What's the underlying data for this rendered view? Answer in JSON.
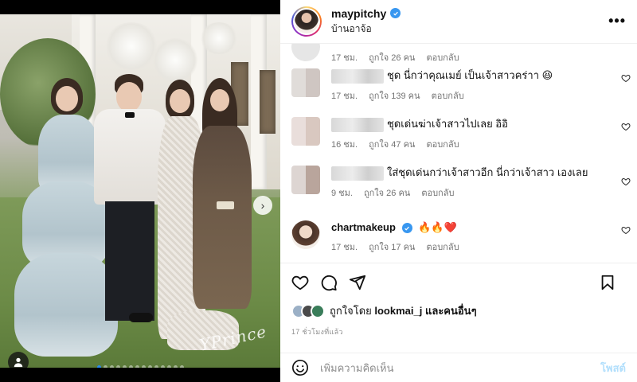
{
  "post": {
    "username": "maypitchy",
    "location": "บ้านอาจ้อ",
    "more_label": "•••",
    "signature": "YPrince",
    "carousel": {
      "dots": 14,
      "active_index": 0
    },
    "colors": {
      "verified": "#3897f0",
      "post_button": "#b2dffc",
      "active_dot": "#2b8cf0"
    }
  },
  "comments": [
    {
      "username": "",
      "text": "",
      "meta": {
        "time": "17 ชม.",
        "likes": "ถูกใจ 26 คน",
        "reply": "ตอบกลับ"
      },
      "partial": true
    },
    {
      "username": "",
      "blurred": true,
      "text": "ชุด นี่กว่าคุณเมย์ เป็นเจ้าสาวคร่าา 😆",
      "meta": {
        "time": "17 ชม.",
        "likes": "ถูกใจ 139 คน",
        "reply": "ตอบกลับ"
      }
    },
    {
      "username": "",
      "blurred": true,
      "text": "ชุดเด่นฆ่าเจ้าสาวไปเลย อิอิ",
      "meta": {
        "time": "16 ชม.",
        "likes": "ถูกใจ 47 คน",
        "reply": "ตอบกลับ"
      }
    },
    {
      "username": "",
      "blurred": true,
      "text": "ใส่ชุดเด่นกว่าเจ้าสาวอีก นี่กว่าเจ้าสาว เองเลย",
      "meta": {
        "time": "9 ชม.",
        "likes": "ถูกใจ 26 คน",
        "reply": "ตอบกลับ"
      }
    },
    {
      "username": "chartmakeup",
      "verified": true,
      "text": "🔥🔥❤️",
      "meta": {
        "time": "17 ชม.",
        "likes": "ถูกใจ 17 คน",
        "reply": "ตอบกลับ"
      }
    }
  ],
  "likes": {
    "prefix": "ถูกใจโดย",
    "user": "lookmai_j",
    "suffix": "และคนอื่นๆ"
  },
  "time_ago": "17 ชั่วโมงที่แล้ว",
  "add_comment": {
    "placeholder": "เพิ่มความคิดเห็น",
    "post_label": "โพสต์"
  },
  "icons": {
    "like": "heart-icon",
    "comment": "comment-icon",
    "share": "share-icon",
    "save": "bookmark-icon",
    "emoji": "emoji-icon",
    "tag": "user-tag-icon",
    "next": "chevron-right-icon"
  }
}
